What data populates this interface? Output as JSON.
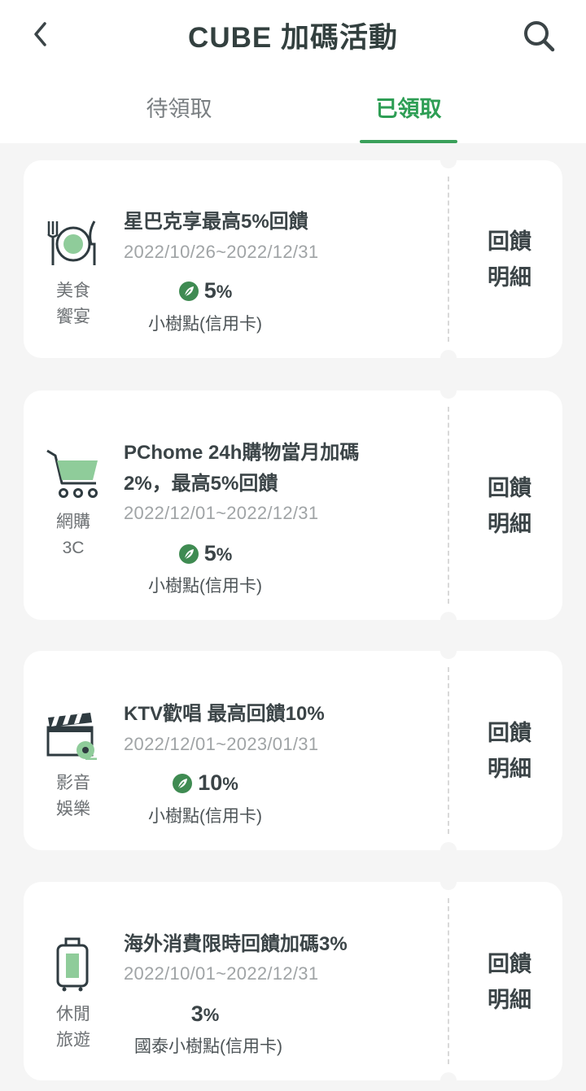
{
  "header": {
    "title": "CUBE 加碼活動",
    "back_icon": "chevron-left-icon",
    "search_icon": "search-icon"
  },
  "tabs": [
    {
      "label": "待領取",
      "active": false
    },
    {
      "label": "已領取",
      "active": true
    }
  ],
  "colors": {
    "accent": "#3aa05a",
    "icon_green": "#8fcc9a",
    "leaf": "#3f8b52"
  },
  "offers": [
    {
      "category_icon": "dining-plate-icon",
      "category_line1": "美食",
      "category_line2": "饗宴",
      "title": "星巴克享最高5%回饋",
      "date": "2022/10/26~2022/12/31",
      "rate_number": "5",
      "rate_unit": "%",
      "reward_type": "小樹點(信用卡)",
      "show_leaf": true,
      "detail_line1": "回饋",
      "detail_line2": "明細"
    },
    {
      "category_icon": "shopping-cart-icon",
      "category_line1": "網購",
      "category_line2": "3C",
      "title": "PChome 24h購物當月加碼2%，最高5%回饋",
      "date": "2022/12/01~2022/12/31",
      "rate_number": "5",
      "rate_unit": "%",
      "reward_type": "小樹點(信用卡)",
      "show_leaf": true,
      "detail_line1": "回饋",
      "detail_line2": "明細"
    },
    {
      "category_icon": "clapperboard-icon",
      "category_line1": "影音",
      "category_line2": "娛樂",
      "title": "KTV歡唱 最高回饋10%",
      "date": "2022/12/01~2023/01/31",
      "rate_number": "10",
      "rate_unit": "%",
      "reward_type": "小樹點(信用卡)",
      "show_leaf": true,
      "detail_line1": "回饋",
      "detail_line2": "明細"
    },
    {
      "category_icon": "suitcase-icon",
      "category_line1": "休閒",
      "category_line2": "旅遊",
      "title": "海外消費限時回饋加碼3%",
      "date": "2022/10/01~2022/12/31",
      "rate_number": "3",
      "rate_unit": "%",
      "reward_type": "國泰小樹點(信用卡)",
      "show_leaf": false,
      "detail_line1": "回饋",
      "detail_line2": "明細"
    }
  ]
}
